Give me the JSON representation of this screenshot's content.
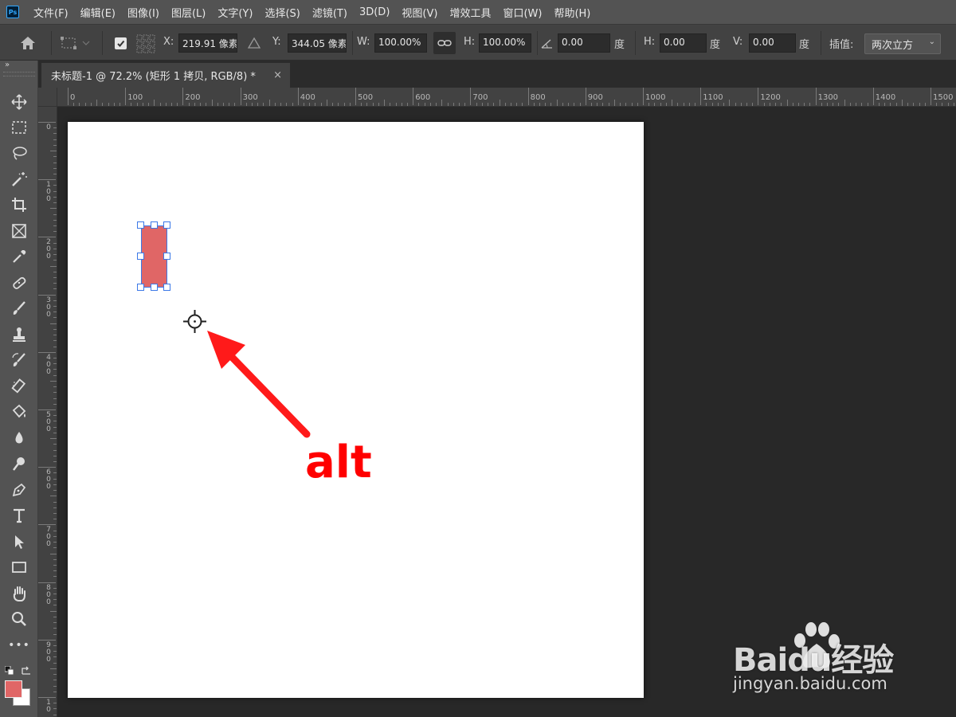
{
  "app": {
    "logo": "Ps"
  },
  "menu": [
    "文件(F)",
    "编辑(E)",
    "图像(I)",
    "图层(L)",
    "文字(Y)",
    "选择(S)",
    "滤镜(T)",
    "3D(D)",
    "视图(V)",
    "增效工具",
    "窗口(W)",
    "帮助(H)"
  ],
  "options": {
    "x_label": "X:",
    "x_value": "219.91 像素",
    "y_label": "Y:",
    "y_value": "344.05 像素",
    "w_label": "W:",
    "w_value": "100.00%",
    "h_label": "H:",
    "h_value": "100.00%",
    "angle_value": "0.00",
    "angle_unit": "度",
    "skew_h_label": "H:",
    "skew_h_value": "0.00",
    "skew_h_unit": "度",
    "skew_v_label": "V:",
    "skew_v_value": "0.00",
    "skew_v_unit": "度",
    "interp_label": "插值:",
    "interp_value": "两次立方"
  },
  "document": {
    "tab_title": "未标题-1 @ 72.2% (矩形 1 拷贝, RGB/8) *",
    "close": "×"
  },
  "rulers": {
    "h_labels": [
      "0",
      "100",
      "200",
      "300",
      "400",
      "500",
      "600",
      "700",
      "800",
      "900",
      "1000",
      "1100",
      "1200",
      "1300",
      "1400",
      "1500"
    ],
    "v_labels": [
      "0",
      "100",
      "200",
      "300",
      "400",
      "500",
      "600",
      "700",
      "800",
      "900",
      "10"
    ]
  },
  "colors": {
    "foreground": "#e06666",
    "background": "#ffffff",
    "selection": "#3b78e7",
    "annotation": "#ff0000"
  },
  "annotation": {
    "text": "alt"
  },
  "watermark": {
    "brand": "Baidu经验",
    "url": "jingyan.baidu.com"
  },
  "toolbar_collapse": "»",
  "tools": [
    "move-tool-icon",
    "marquee-tool-icon",
    "lasso-tool-icon",
    "magic-wand-icon",
    "crop-tool-icon",
    "frame-tool-icon",
    "eyedropper-icon",
    "healing-brush-icon",
    "brush-tool-icon",
    "stamp-tool-icon",
    "history-brush-icon",
    "eraser-icon",
    "paint-bucket-icon",
    "blur-drop-icon",
    "dodge-tool-icon",
    "pen-tool-icon",
    "type-tool-icon",
    "path-select-icon",
    "rectangle-tool-icon",
    "hand-tool-icon",
    "zoom-tool-icon",
    "more-tools-icon"
  ],
  "more_tools_glyph": "•••"
}
